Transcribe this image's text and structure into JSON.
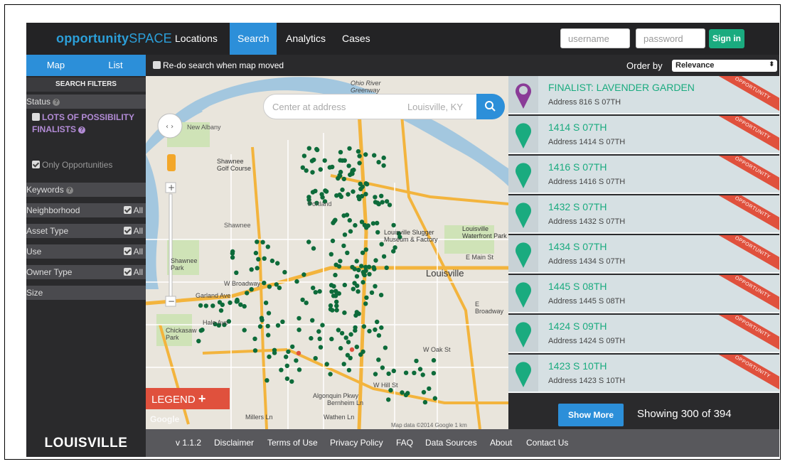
{
  "brand": {
    "part1": "opportunity",
    "part2": "SPACE"
  },
  "nav": [
    {
      "label": "Locations"
    },
    {
      "label": "Search"
    },
    {
      "label": "Analytics"
    },
    {
      "label": "Cases"
    }
  ],
  "auth": {
    "username_placeholder": "username",
    "password_placeholder": "password",
    "signin_label": "Sign in"
  },
  "sidebar": {
    "tabs": [
      {
        "label": "Map"
      },
      {
        "label": "List"
      }
    ],
    "filters_header": "SEARCH FILTERS",
    "status_label": "Status",
    "status_option": "LOTS OF POSSIBILITY FINALISTS",
    "only_opportunities": "Only Opportunities",
    "keywords_label": "Keywords",
    "filters": [
      {
        "label": "Neighborhood",
        "value": "All"
      },
      {
        "label": "Asset Type",
        "value": "All"
      },
      {
        "label": "Use",
        "value": "All"
      },
      {
        "label": "Owner Type",
        "value": "All"
      }
    ],
    "size_label": "Size"
  },
  "map": {
    "redo_label": "Re-do search when map moved",
    "search_placeholder": "Center at address",
    "search_location": "Louisville, KY",
    "legend_label": "LEGEND",
    "legend_plus": "+",
    "google": "Google",
    "map_data": "Map data ©2014 Google   1 km",
    "labels": [
      {
        "text": "New Albany"
      },
      {
        "text": "Shawnee Golf Course"
      },
      {
        "text": "Shawnee"
      },
      {
        "text": "Shawnee Park"
      },
      {
        "text": "Portland"
      },
      {
        "text": "Louisville Slugger Museum & Factory"
      },
      {
        "text": "Louisville Waterfront Park"
      },
      {
        "text": "Louisville"
      },
      {
        "text": "W Broadway"
      },
      {
        "text": "Garland Ave"
      },
      {
        "text": "Chickasaw Park"
      },
      {
        "text": "Hale Ave"
      },
      {
        "text": "Algonquin Pkwy"
      },
      {
        "text": "Bernheim Ln"
      },
      {
        "text": "Ohio River Greenway"
      },
      {
        "text": "E Main St"
      },
      {
        "text": "E Broadway"
      },
      {
        "text": "W Oak St"
      },
      {
        "text": "W Hill St"
      },
      {
        "text": "Millers Ln"
      },
      {
        "text": "Wathen Ln"
      }
    ]
  },
  "results": {
    "order_label": "Order by",
    "order_value": "Relevance",
    "ribbon_label": "OPPORTUNITY",
    "items": [
      {
        "title": "FINALIST: LAVENDER GARDEN",
        "address": "Address 816 S 07TH",
        "finalist": true
      },
      {
        "title": "1414 S 07TH",
        "address": "Address 1414 S 07TH"
      },
      {
        "title": "1416 S 07TH",
        "address": "Address 1416 S 07TH"
      },
      {
        "title": "1432 S 07TH",
        "address": "Address 1432 S 07TH"
      },
      {
        "title": "1434 S 07TH",
        "address": "Address 1434 S 07TH"
      },
      {
        "title": "1445 S 08TH",
        "address": "Address 1445 S 08TH"
      },
      {
        "title": "1424 S 09TH",
        "address": "Address 1424 S 09TH"
      },
      {
        "title": "1423 S 10TH",
        "address": "Address 1423 S 10TH"
      }
    ],
    "show_more_label": "Show More",
    "showing_text": "Showing 300 of 394"
  },
  "footer": {
    "brand": "LOUISVILLE",
    "links": [
      {
        "label": "v 1.1.2"
      },
      {
        "label": "Disclaimer"
      },
      {
        "label": "Terms of Use"
      },
      {
        "label": "Privacy Policy"
      },
      {
        "label": "FAQ"
      },
      {
        "label": "Data Sources"
      },
      {
        "label": "About"
      },
      {
        "label": "Contact Us"
      }
    ]
  },
  "colors": {
    "accent_blue": "#2c8fd9",
    "brand_blue": "#2c9fd9",
    "green": "#1aab7f",
    "dot_green": "#0d6b3a",
    "ribbon_red": "#e0513d",
    "finalist_purple": "#b28bd6"
  }
}
